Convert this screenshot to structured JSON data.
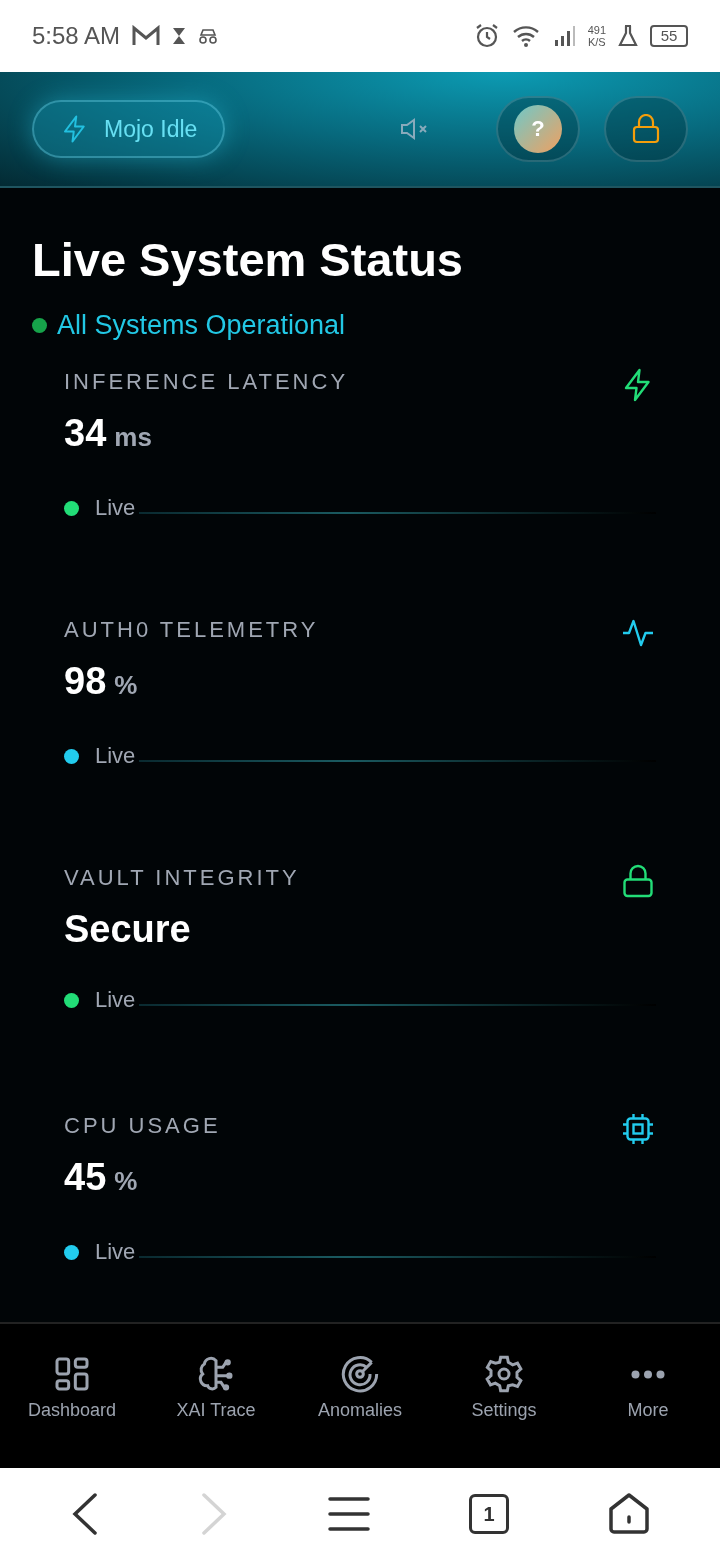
{
  "status_bar": {
    "time": "5:58 AM",
    "net_speed_value": "491",
    "net_speed_unit": "K/S",
    "battery": "55"
  },
  "header": {
    "mode_button": "Mojo Idle",
    "muted": true,
    "help_label": "?"
  },
  "title": "Live System Status",
  "system_status": {
    "text": "All Systems Operational",
    "color": "#16a34a"
  },
  "metrics": [
    {
      "label": "INFERENCE LATENCY",
      "value": "34",
      "unit": "ms",
      "kind": "bolt",
      "color": "#22dd77",
      "live": "Live"
    },
    {
      "label": "AUTH0 TELEMETRY",
      "value": "98",
      "unit": "%",
      "kind": "pulse",
      "color": "#22ccee",
      "live": "Live"
    },
    {
      "label": "VAULT INTEGRITY",
      "value": "Secure",
      "kind": "lock",
      "color": "#22dd77",
      "live": "Live"
    },
    {
      "label": "CPU USAGE",
      "value": "45",
      "unit": "%",
      "kind": "chip",
      "color": "#22ccee",
      "live": "Live"
    }
  ],
  "nav": [
    {
      "label": "Dashboard",
      "kind": "grid"
    },
    {
      "label": "XAI Trace",
      "kind": "brain"
    },
    {
      "label": "Anomalies",
      "kind": "radar"
    },
    {
      "label": "Settings",
      "kind": "gear"
    },
    {
      "label": "More",
      "kind": "dots"
    }
  ],
  "browser_bar": {
    "back_disabled": false,
    "forward_disabled": true,
    "tab_count": "1"
  }
}
